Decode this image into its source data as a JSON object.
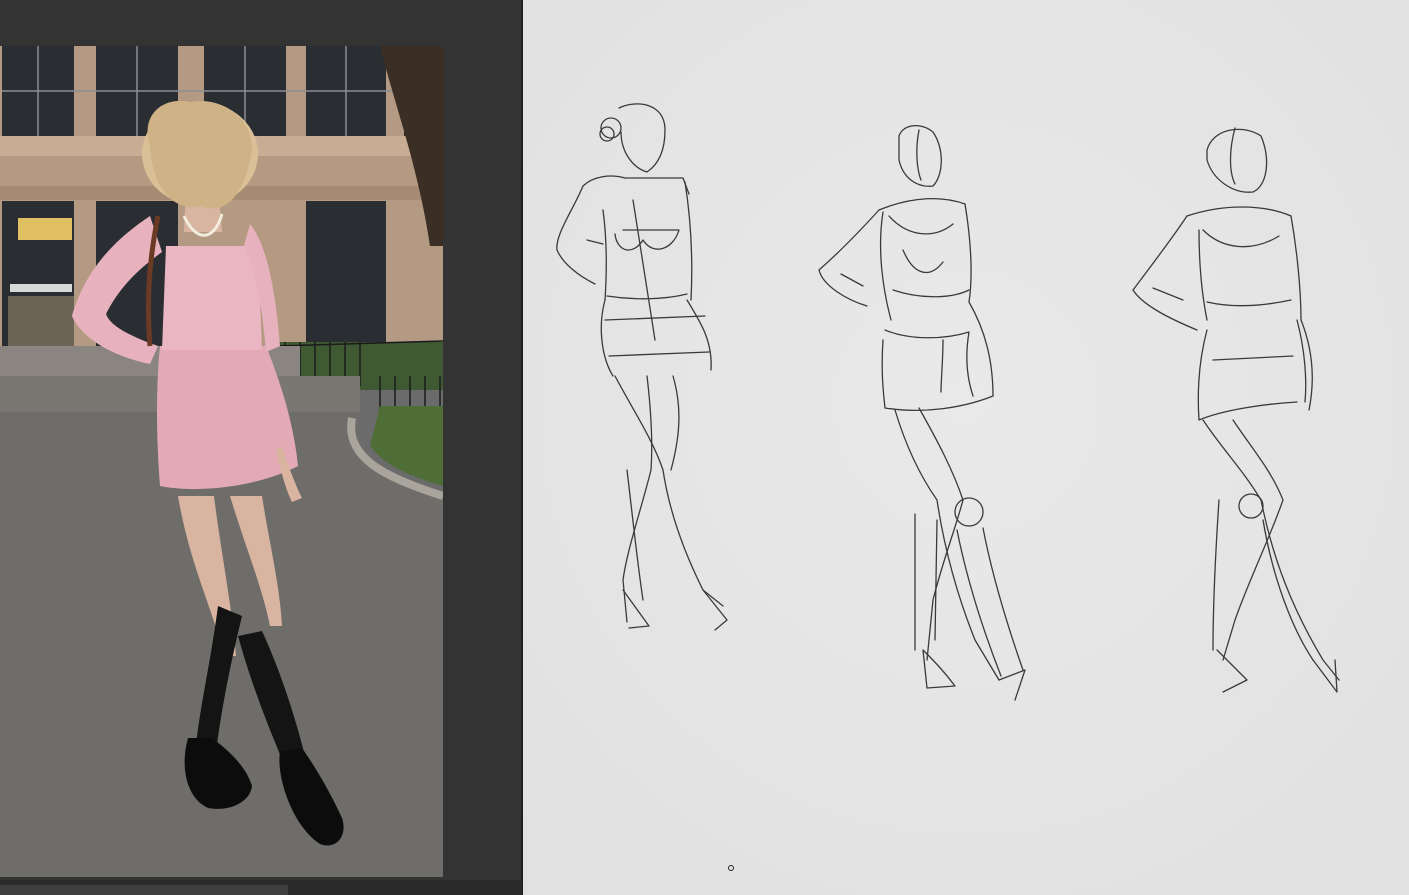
{
  "layout": {
    "reference_panel": "left",
    "drawing_canvas": "right"
  },
  "colors": {
    "panel_background": "#333333",
    "canvas_background": "#e6e6e6",
    "sketch_stroke": "#3a3a3a",
    "outfit_pink": "#e7b2bd",
    "hair_blonde": "#d9c096",
    "socks_black": "#141414"
  },
  "reference": {
    "icon": "reference-photo-icon"
  },
  "canvas": {
    "sketch_count": 3,
    "cursor_icon": "pen-cursor-icon"
  }
}
